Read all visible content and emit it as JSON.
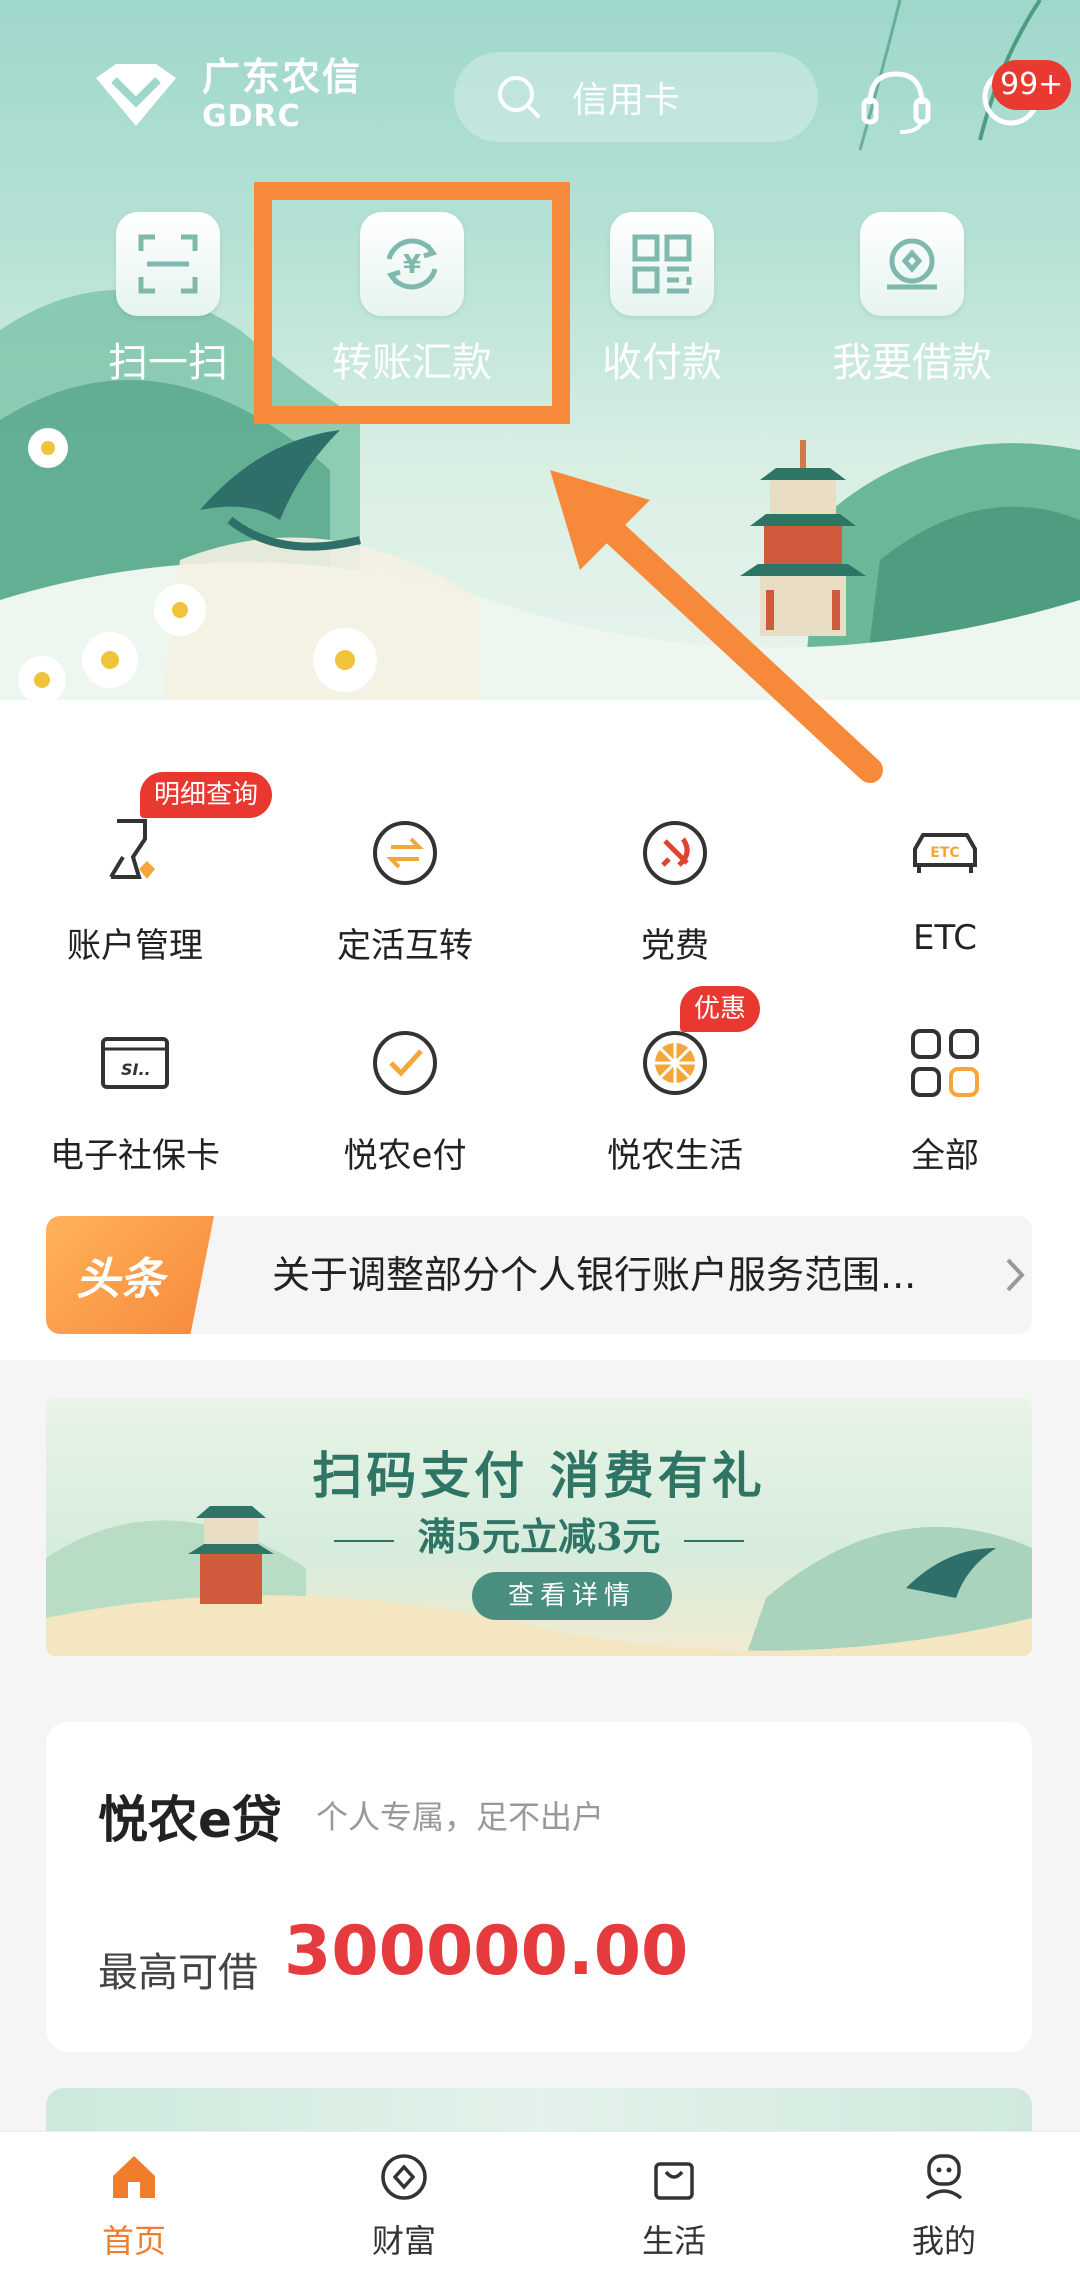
{
  "header": {
    "logo_cn": "广东农信",
    "logo_en": "GDRC",
    "search_placeholder": "信用卡",
    "message_badge": "99+"
  },
  "quick_actions": [
    {
      "label": "扫一扫",
      "icon": "scan-icon"
    },
    {
      "label": "转账汇款",
      "icon": "transfer-icon"
    },
    {
      "label": "收付款",
      "icon": "qr-code-icon"
    },
    {
      "label": "我要借款",
      "icon": "loan-icon"
    }
  ],
  "services": [
    {
      "label": "账户管理",
      "icon": "account-icon",
      "badge": "明细查询"
    },
    {
      "label": "定活互转",
      "icon": "exchange-icon"
    },
    {
      "label": "党费",
      "icon": "party-fee-icon"
    },
    {
      "label": "ETC",
      "icon": "etc-car-icon"
    },
    {
      "label": "电子社保卡",
      "icon": "social-security-card-icon"
    },
    {
      "label": "悦农e付",
      "icon": "epay-icon"
    },
    {
      "label": "悦农生活",
      "icon": "life-icon",
      "badge": "优惠"
    },
    {
      "label": "全部",
      "icon": "grid-all-icon"
    }
  ],
  "headline": {
    "tag": "头条",
    "text": "关于调整部分个人银行账户服务范围..."
  },
  "promo": {
    "title": "扫码支付 消费有礼",
    "subtitle": "满5元立减3元",
    "button": "查看详情"
  },
  "loan": {
    "title": "悦农e贷",
    "subtitle": "个人专属，足不出户",
    "label": "最高可借",
    "amount": "300000.00"
  },
  "tabs": [
    {
      "label": "首页",
      "icon": "home-icon",
      "active": true
    },
    {
      "label": "财富",
      "icon": "wealth-icon",
      "active": false
    },
    {
      "label": "生活",
      "icon": "shopping-bag-icon",
      "active": false
    },
    {
      "label": "我的",
      "icon": "profile-icon",
      "active": false
    }
  ],
  "colors": {
    "accent": "#f07d2c",
    "highlight": "#f7893b",
    "amount": "#e53b3f",
    "badge": "#e8382f",
    "hero_green": "#9fd7cc"
  }
}
